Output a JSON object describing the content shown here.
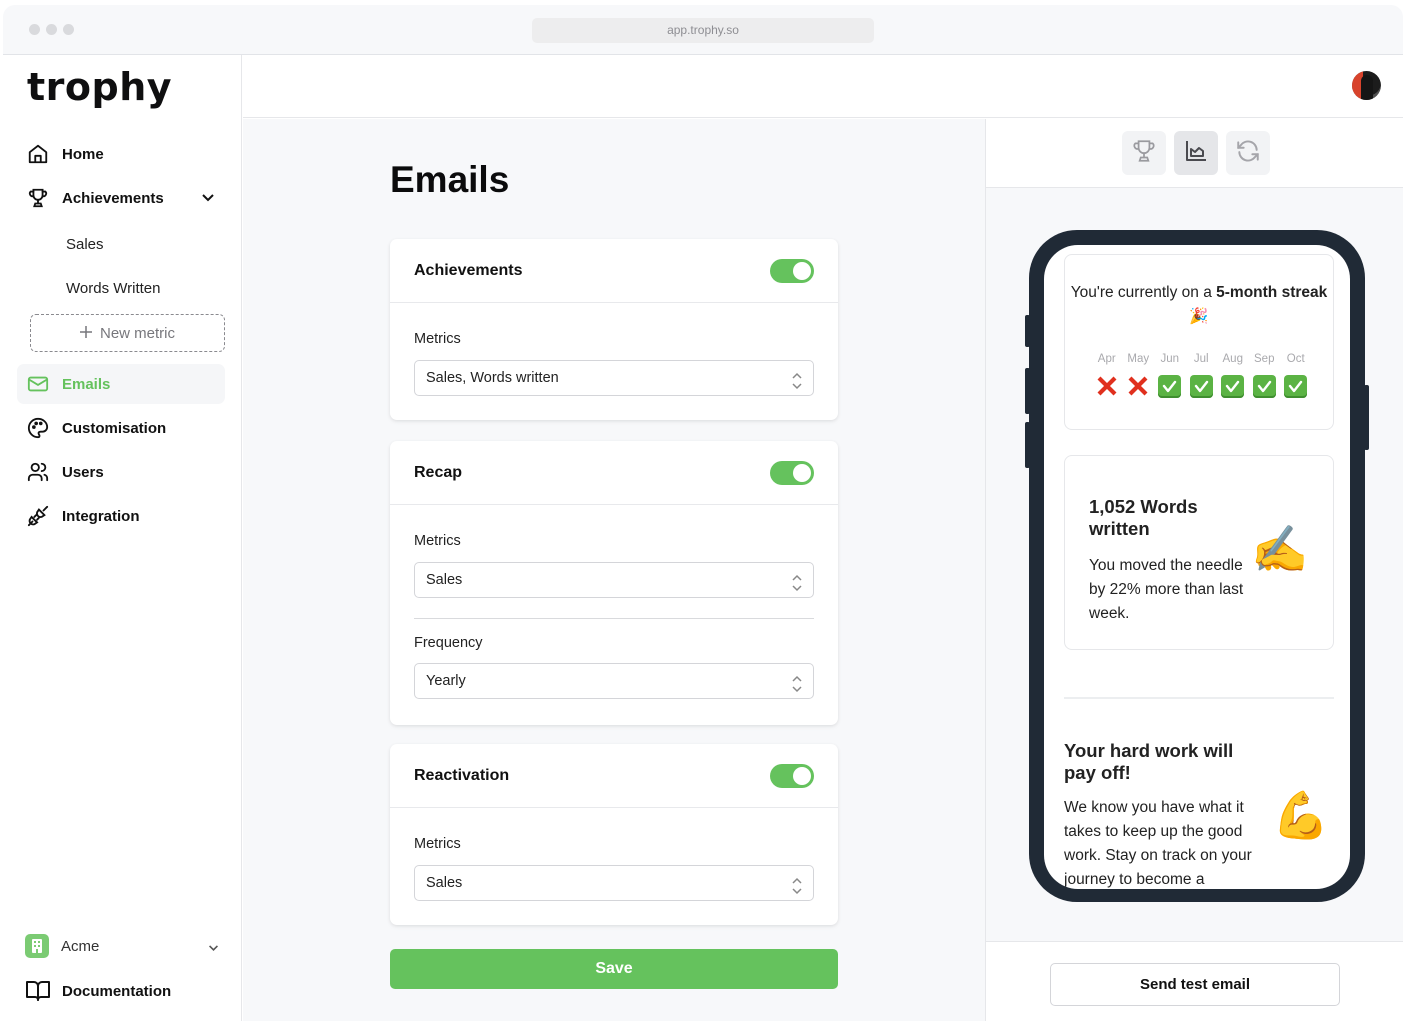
{
  "browser": {
    "url": "app.trophy.so"
  },
  "sidebar": {
    "logo": "trophy",
    "items": [
      {
        "label": "Home",
        "icon": "home-icon"
      },
      {
        "label": "Achievements",
        "icon": "trophy-icon",
        "expanded": true
      },
      {
        "label": "Emails",
        "icon": "mail-icon",
        "active": true
      },
      {
        "label": "Customisation",
        "icon": "palette-icon"
      },
      {
        "label": "Users",
        "icon": "users-icon"
      },
      {
        "label": "Integration",
        "icon": "plug-icon"
      }
    ],
    "achievement_subitems": [
      "Sales",
      "Words Written"
    ],
    "new_metric_label": "New metric",
    "org": {
      "name": "Acme",
      "icon": "building-icon"
    },
    "documentation_label": "Documentation"
  },
  "colors": {
    "accent": "#65c25d",
    "phone_frame": "#202a36"
  },
  "main": {
    "title": "Emails",
    "sections": [
      {
        "title": "Achievements",
        "enabled": true,
        "fields": [
          {
            "label": "Metrics",
            "value": "Sales, Words written"
          }
        ]
      },
      {
        "title": "Recap",
        "enabled": true,
        "fields": [
          {
            "label": "Metrics",
            "value": "Sales"
          },
          {
            "label": "Frequency",
            "value": "Yearly"
          }
        ]
      },
      {
        "title": "Reactivation",
        "enabled": true,
        "fields": [
          {
            "label": "Metrics",
            "value": "Sales"
          }
        ]
      }
    ],
    "save_label": "Save"
  },
  "preview": {
    "tabs": [
      {
        "name": "achievements",
        "icon": "trophy-icon",
        "active": false
      },
      {
        "name": "recap",
        "icon": "chart-icon",
        "active": true
      },
      {
        "name": "reactivation",
        "icon": "refresh-icon",
        "active": false
      }
    ],
    "streak": {
      "text_prefix": "You're currently on a ",
      "text_bold": "5-month streak",
      "emoji": "🎉",
      "months": [
        {
          "label": "Apr",
          "status": "miss"
        },
        {
          "label": "May",
          "status": "miss"
        },
        {
          "label": "Jun",
          "status": "hit"
        },
        {
          "label": "Jul",
          "status": "hit"
        },
        {
          "label": "Aug",
          "status": "hit"
        },
        {
          "label": "Sep",
          "status": "hit"
        },
        {
          "label": "Oct",
          "status": "hit"
        }
      ]
    },
    "words": {
      "headline": "1,052 Words written",
      "body": "You moved the needle by 22% more than last week.",
      "emoji": "✍️"
    },
    "reactivation": {
      "headline": "Your hard work will pay off!",
      "body": "We know you have what it takes to keep up the good work. Stay on track on your journey to become a",
      "emoji": "💪"
    },
    "send_test_label": "Send test email"
  }
}
